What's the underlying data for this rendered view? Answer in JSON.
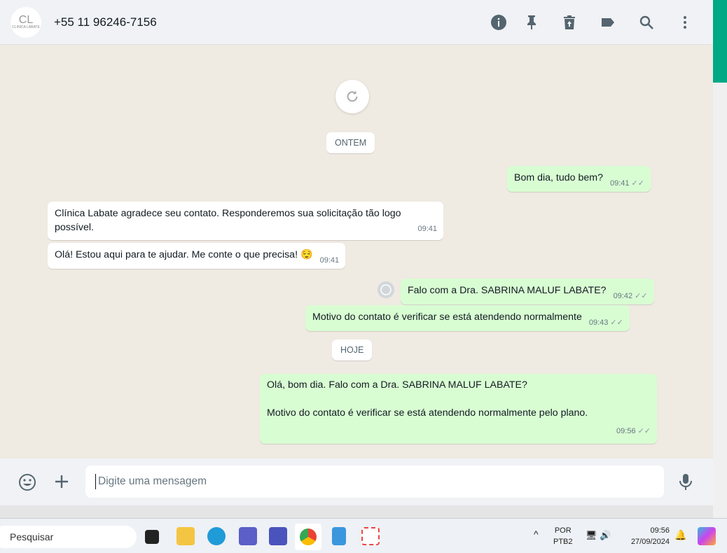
{
  "header": {
    "contact": "+55 11 96246-7156",
    "avatar_text": "CLINICA LABATE",
    "icons": [
      "info-icon",
      "pin-icon",
      "delete-icon",
      "label-icon",
      "search-icon",
      "more-icon"
    ]
  },
  "chat": {
    "dates": [
      "ONTEM",
      "HOJE"
    ],
    "messages": [
      {
        "dir": "out",
        "text": "Bom dia, tudo bem?",
        "time": "09:41"
      },
      {
        "dir": "in",
        "text": "Clínica Labate  agradece seu contato. Responderemos sua solicitação tão logo possível.",
        "time": "09:41"
      },
      {
        "dir": "in",
        "text": "Olá! Estou aqui para te ajudar. Me conte o que precisa! 😌",
        "time": "09:41"
      },
      {
        "dir": "out",
        "text": "Falo com a Dra. SABRINA MALUF LABATE?",
        "time": "09:42"
      },
      {
        "dir": "out",
        "text": "Motivo do contato é verificar se está atendendo normalmente",
        "time": "09:43"
      },
      {
        "dir": "out",
        "text": "Olá, bom dia. Falo com a Dra. SABRINA MALUF LABATE?",
        "text2": "Motivo do contato é verificar se está atendendo normalmente pelo plano.",
        "time": "09:56"
      }
    ]
  },
  "composer": {
    "placeholder": "Digite uma mensagem"
  },
  "taskbar": {
    "search": "Pesquisar",
    "lang1": "POR",
    "lang2": "PTB2",
    "clock": "09:56",
    "date": "27/09/2024"
  },
  "colors": {
    "accent": "#00a884",
    "outgoing": "#d9fdd3"
  }
}
